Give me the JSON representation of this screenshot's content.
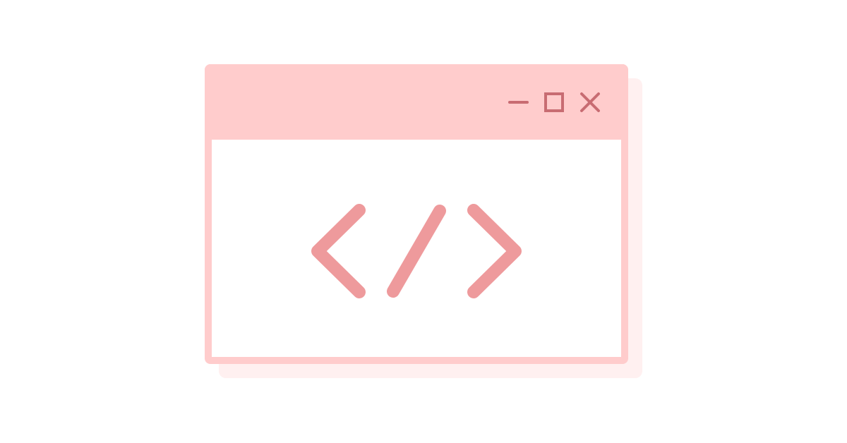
{
  "colors": {
    "background": "#ffffff",
    "window_frame": "#ffcccc",
    "window_shadow": "#fff0f0",
    "content_background": "#ffffff",
    "control_icons": "#c86c72",
    "code_symbol": "#ee9a9c"
  },
  "window": {
    "controls": [
      {
        "name": "minimize",
        "icon": "minimize-icon"
      },
      {
        "name": "maximize",
        "icon": "maximize-icon"
      },
      {
        "name": "close",
        "icon": "close-icon"
      }
    ],
    "content": {
      "icon": "code-brackets-icon"
    }
  }
}
